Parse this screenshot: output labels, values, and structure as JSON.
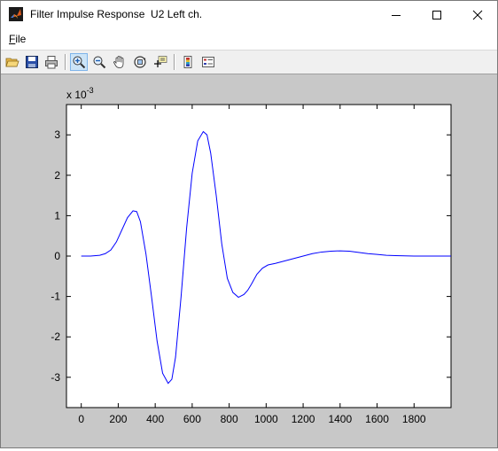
{
  "window": {
    "title": "Filter Impulse Response  U2 Left ch.",
    "minimize_label": "minimize",
    "maximize_label": "maximize",
    "close_label": "close"
  },
  "menu": {
    "file_label_first": "F",
    "file_label_rest": "ile"
  },
  "toolbar": {
    "items": [
      {
        "name": "open-icon"
      },
      {
        "name": "save-icon"
      },
      {
        "name": "print-icon"
      },
      {
        "name": "zoom-in-icon",
        "active": true
      },
      {
        "name": "zoom-out-icon"
      },
      {
        "name": "pan-hand-icon"
      },
      {
        "name": "rotate-3d-icon"
      },
      {
        "name": "data-cursor-icon"
      },
      {
        "name": "colorbar-icon"
      },
      {
        "name": "legend-icon"
      }
    ]
  },
  "chart_data": {
    "type": "line",
    "title": "",
    "xlabel": "",
    "ylabel": "",
    "y_exponent_label": "x 10",
    "y_exponent_power": "-3",
    "xlim": [
      -80,
      2000
    ],
    "ylim": [
      -3.75,
      3.75
    ],
    "xticks": [
      0,
      200,
      400,
      600,
      800,
      1000,
      1200,
      1400,
      1600,
      1800
    ],
    "yticks": [
      -3,
      -2,
      -1,
      0,
      1,
      2,
      3
    ],
    "line_color": "#0000ff",
    "grid": false,
    "series": [
      {
        "x": [
          0,
          50,
          100,
          130,
          160,
          190,
          220,
          250,
          280,
          300,
          320,
          350,
          380,
          410,
          440,
          470,
          490,
          510,
          540,
          570,
          600,
          630,
          660,
          680,
          700,
          730,
          760,
          790,
          820,
          850,
          880,
          900,
          920,
          950,
          980,
          1010,
          1050,
          1100,
          1150,
          1200,
          1250,
          1300,
          1350,
          1400,
          1450,
          1500,
          1550,
          1600,
          1650,
          1700,
          1800,
          1900,
          2000
        ],
        "y": [
          0,
          0,
          0.02,
          0.06,
          0.15,
          0.35,
          0.65,
          0.95,
          1.12,
          1.1,
          0.85,
          0.05,
          -1.0,
          -2.1,
          -2.9,
          -3.15,
          -3.05,
          -2.5,
          -1.0,
          0.7,
          2.05,
          2.85,
          3.08,
          3.0,
          2.55,
          1.5,
          0.3,
          -0.55,
          -0.9,
          -1.02,
          -0.95,
          -0.85,
          -0.7,
          -0.45,
          -0.3,
          -0.22,
          -0.18,
          -0.12,
          -0.06,
          0.0,
          0.06,
          0.1,
          0.12,
          0.13,
          0.12,
          0.09,
          0.06,
          0.04,
          0.02,
          0.01,
          0,
          0,
          0
        ]
      }
    ]
  }
}
